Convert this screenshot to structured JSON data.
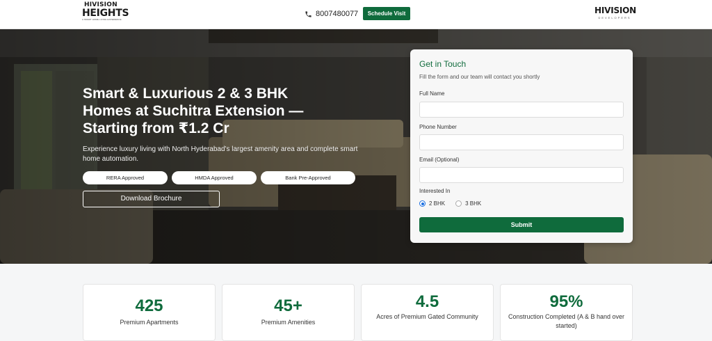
{
  "header": {
    "logo_left_line1": "HIVISION",
    "logo_left_line2": "HEIGHTS",
    "logo_left_tagline": "A SMART HOME LIVING EXPERIENCE",
    "phone": "8007480077",
    "schedule_label": "Schedule Visit",
    "logo_right_line1": "HIVISION",
    "logo_right_line2": "DEVELOPERS"
  },
  "hero": {
    "title": "Smart & Luxurious 2 & 3 BHK Homes at Suchitra Extension — Starting from ₹1.2 Cr",
    "subtitle": "Experience luxury living with North Hyderabad's largest amenity area and complete smart home automation.",
    "badges": [
      "RERA Approved",
      "HMDA Approved",
      "Bank Pre-Approved"
    ],
    "brochure_label": "Download Brochure"
  },
  "form": {
    "title": "Get in Touch",
    "subtitle": "Fill the form and our team will contact you shortly",
    "full_name_label": "Full Name",
    "full_name_value": "",
    "phone_label": "Phone Number",
    "phone_value": "",
    "email_label": "Email (Optional)",
    "email_value": "",
    "interest_label": "Interested In",
    "options": [
      "2 BHK",
      "3 BHK"
    ],
    "selected": "2 BHK",
    "submit_label": "Submit"
  },
  "stats": [
    {
      "value": "425",
      "label": "Premium Apartments"
    },
    {
      "value": "45+",
      "label": "Premium Amenities"
    },
    {
      "value": "4.5",
      "label": "Acres of Premium Gated Community"
    },
    {
      "value": "95%",
      "label": "Construction Completed (A & B hand over started)"
    }
  ],
  "colors": {
    "brand_green": "#0f6b3c",
    "radio_blue": "#1b6fe0"
  }
}
